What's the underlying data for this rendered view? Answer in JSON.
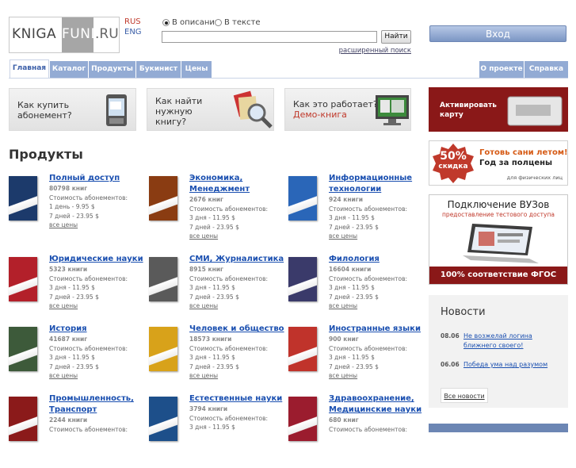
{
  "header": {
    "logo_part1": "KNIGA",
    "logo_part2": "FUND",
    "logo_part3": ".RU",
    "lang_rus": "RUS",
    "lang_eng": "ENG",
    "radio_desc": "В описании",
    "radio_text": "В тексте",
    "search_placeholder": "",
    "search_button": "Найти",
    "advanced_search": "расширенный поиск",
    "login": "Вход"
  },
  "nav": {
    "left": [
      "Главная",
      "Каталог",
      "Продукты",
      "Букинист",
      "Цены"
    ],
    "right": [
      "О проекте",
      "Справка"
    ]
  },
  "banners": {
    "b1": [
      "Как купить",
      "абонемент?"
    ],
    "b2": [
      "Как найти",
      "нужную",
      "книгу?"
    ],
    "b3_line1": "Как это работает?",
    "b3_demo": "Демо-книга",
    "activate": [
      "Активировать",
      "карту"
    ],
    "promo_percent": "50%",
    "promo_discount": "скидка",
    "promo_line1": "Готовь сани летом!",
    "promo_line2": "Год за полцены",
    "promo_note": "для физических лиц",
    "vuz_title": "Подключение ВУЗов",
    "vuz_sub": "предоставление тестового доступа",
    "vuz_footer": "100% соответствие ФГОС"
  },
  "products_title": "Продукты",
  "products": [
    {
      "name": [
        "Полный доступ"
      ],
      "count": "80798 книг",
      "price_label": "Стоимость абонементов:",
      "prices": [
        "1 день - 9.95 $",
        "7 дней - 23.95 $"
      ],
      "all": "все цены",
      "color": "#1c3a6b"
    },
    {
      "name": [
        "Экономика,",
        "Менеджмент"
      ],
      "count": "2676 книг",
      "price_label": "Стоимость абонементов:",
      "prices": [
        "3 дня - 11.95 $",
        "7 дней - 23.95 $"
      ],
      "all": "все цены",
      "color": "#8a3c12"
    },
    {
      "name": [
        "Информационные",
        "технологии"
      ],
      "count": "924 книги",
      "price_label": "Стоимость абонементов:",
      "prices": [
        "3 дня - 11.95 $",
        "7 дней - 23.95 $"
      ],
      "all": "все цены",
      "color": "#2a66b8"
    },
    {
      "name": [
        "Юридические науки"
      ],
      "count": "5323 книги",
      "price_label": "Стоимость абонементов:",
      "prices": [
        "3 дня - 11.95 $",
        "7 дней - 23.95 $"
      ],
      "all": "все цены",
      "color": "#b3202a"
    },
    {
      "name": [
        "СМИ, Журналистика"
      ],
      "count": "8915 книг",
      "price_label": "Стоимость абонементов:",
      "prices": [
        "3 дня - 11.95 $",
        "7 дней - 23.95 $"
      ],
      "all": "все цены",
      "color": "#5a5a5a"
    },
    {
      "name": [
        "Филология"
      ],
      "count": "16604 книги",
      "price_label": "Стоимость абонементов:",
      "prices": [
        "3 дня - 11.95 $",
        "7 дней - 23.95 $"
      ],
      "all": "все цены",
      "color": "#3a3a6a"
    },
    {
      "name": [
        "История"
      ],
      "count": "41687 книг",
      "price_label": "Стоимость абонементов:",
      "prices": [
        "3 дня - 11.95 $",
        "7 дней - 23.95 $"
      ],
      "all": "все цены",
      "color": "#3d5a3a"
    },
    {
      "name": [
        "Человек и общество"
      ],
      "count": "18573 книги",
      "price_label": "Стоимость абонементов:",
      "prices": [
        "3 дня - 11.95 $",
        "7 дней - 23.95 $"
      ],
      "all": "все цены",
      "color": "#d8a21a"
    },
    {
      "name": [
        "Иностранные языки"
      ],
      "count": "900 книг",
      "price_label": "Стоимость абонементов:",
      "prices": [
        "3 дня - 11.95 $",
        "7 дней - 23.95 $"
      ],
      "all": "все цены",
      "color": "#c0332b"
    },
    {
      "name": [
        "Промышленность,",
        "Транспорт"
      ],
      "count": "2244 книги",
      "price_label": "Стоимость абонементов:",
      "prices": [],
      "all": "",
      "color": "#8b1a1a"
    },
    {
      "name": [
        "Естественные науки"
      ],
      "count": "3794 книги",
      "price_label": "Стоимость абонементов:",
      "prices": [
        "3 дня - 11.95 $"
      ],
      "all": "",
      "color": "#1d4f8a"
    },
    {
      "name": [
        "Здравоохранение,",
        "Медицинские науки"
      ],
      "count": "680 книг",
      "price_label": "Стоимость абонементов:",
      "prices": [],
      "all": "",
      "color": "#9b1c2e"
    }
  ],
  "news": {
    "title": "Новости",
    "items": [
      {
        "date": "08.06",
        "text": [
          "Не возжелай логина",
          "ближнего своего!"
        ]
      },
      {
        "date": "06.06",
        "text": [
          "Победа ума над разумом"
        ]
      }
    ],
    "all": "Все новости"
  },
  "colors": {
    "nav_bg": "#93abd4",
    "link": "#1a4fb0",
    "accent_red": "#c0392b"
  }
}
